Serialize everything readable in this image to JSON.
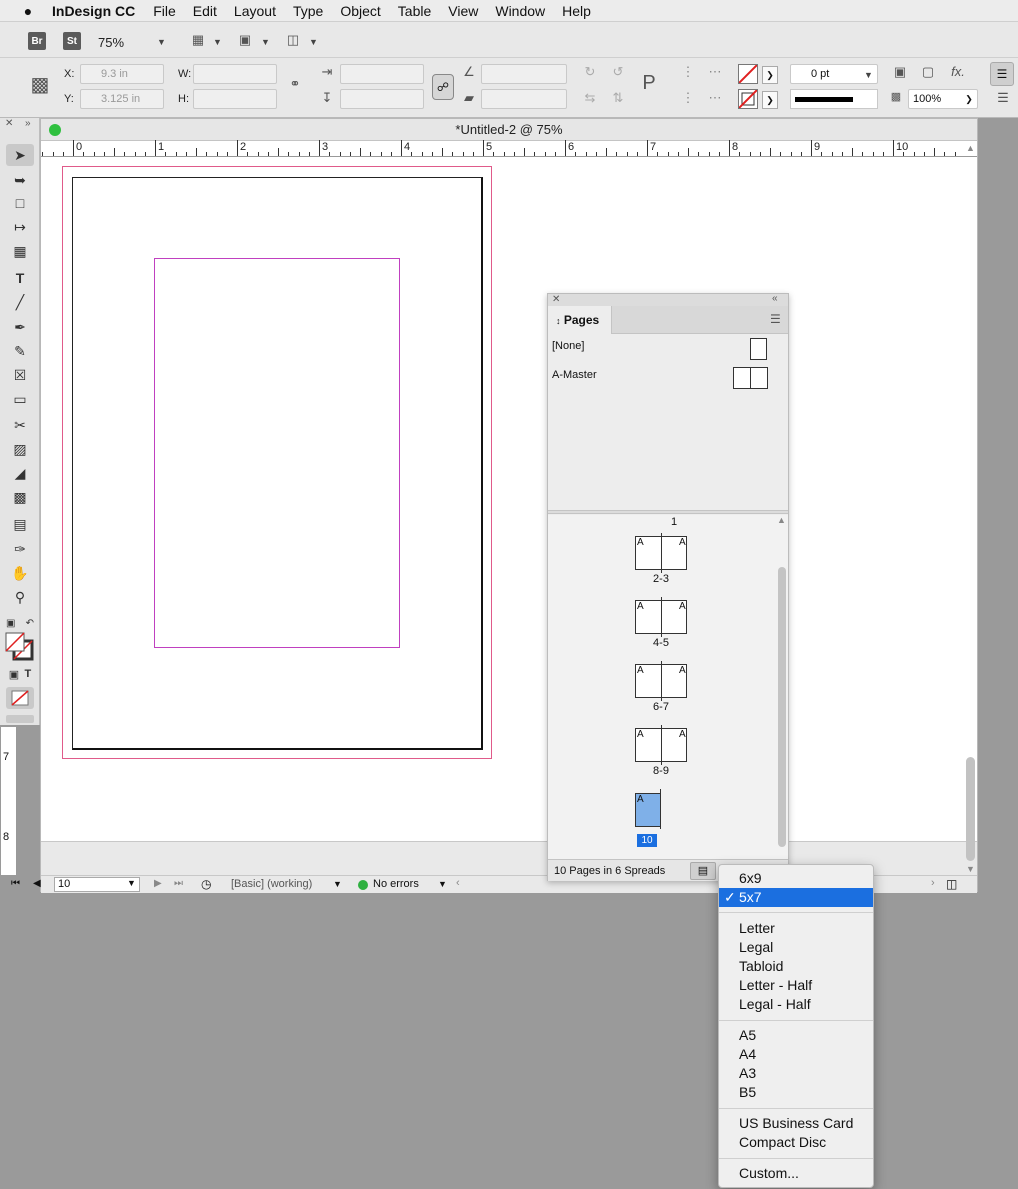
{
  "menubar": {
    "app_name": "InDesign CC",
    "items": [
      "File",
      "Edit",
      "Layout",
      "Type",
      "Object",
      "Table",
      "View",
      "Window",
      "Help"
    ]
  },
  "control": {
    "bridge_badge": "Br",
    "stock_badge": "St",
    "zoom": "75%",
    "x_label": "X:",
    "y_label": "Y:",
    "w_label": "W:",
    "h_label": "H:",
    "x_value": "9.3 in",
    "y_value": "3.125 in",
    "stroke_weight": "0 pt",
    "opacity": "100%"
  },
  "document": {
    "title": "*Untitled-2 @ 75%",
    "ruler_numbers": [
      "0",
      "1",
      "2",
      "3",
      "4",
      "5",
      "6",
      "7",
      "8",
      "9",
      "10"
    ],
    "vruler_numbers": [
      "7",
      "8"
    ]
  },
  "status": {
    "page_field": "10",
    "preflight_profile": "[Basic] (working)",
    "errors": "No errors"
  },
  "pages_panel": {
    "tab": "Pages",
    "masters": [
      "[None]",
      "A-Master"
    ],
    "spread_labels": [
      "1",
      "2-3",
      "4-5",
      "6-7",
      "8-9",
      "10"
    ],
    "master_letter": "A",
    "footer": "10 Pages in 6 Spreads"
  },
  "size_menu": {
    "groups": [
      [
        "6x9",
        "5x7"
      ],
      [
        "Letter",
        "Legal",
        "Tabloid",
        "Letter - Half",
        "Legal - Half"
      ],
      [
        "A5",
        "A4",
        "A3",
        "B5"
      ],
      [
        "US Business Card",
        "Compact Disc"
      ],
      [
        "Custom..."
      ]
    ],
    "selected": "5x7",
    "checkmark": "✓"
  },
  "colors": {
    "selection": "#1b6fe0",
    "margin_guide": "#c040c0",
    "bleed_guide": "#e05a8a",
    "current_page": "#7fb0e8",
    "page_badge": "#1b6fe0"
  }
}
